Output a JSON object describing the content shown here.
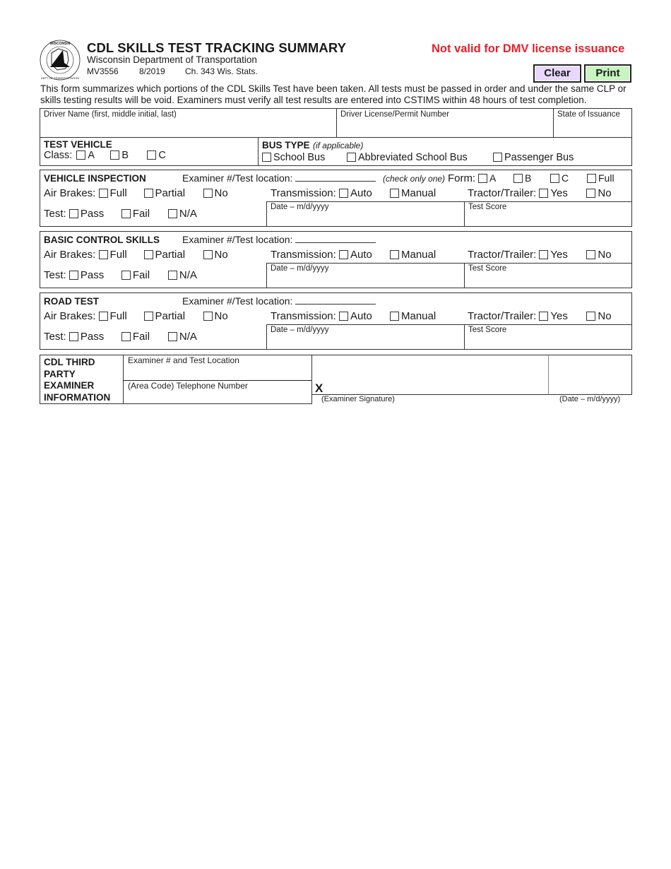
{
  "header": {
    "logo_text_top": "WISCONSIN",
    "logo_text_bottom": "DEPARTMENT OF TRANSPORTATION",
    "title": "CDL SKILLS TEST TRACKING SUMMARY",
    "department": "Wisconsin Department of Transportation",
    "form_number": "MV3556",
    "form_date": "8/2019",
    "statute": "Ch. 343 Wis. Stats.",
    "warning": "Not valid for DMV license issuance",
    "clear_label": "Clear",
    "print_label": "Print",
    "colors": {
      "warning": "#e8202a",
      "clear_bg": "#e8d8ff",
      "print_bg": "#c8f5c0"
    }
  },
  "intro": "This form summarizes which portions of the CDL Skills Test have been taken. All tests must be passed in order and under the same CLP or skills testing results will be void. Examiners must verify all test results are entered into CSTIMS within 48 hours of test completion.",
  "driver": {
    "name_label": "Driver Name (first, middle initial, last)",
    "name_value": "",
    "license_label": "Driver License/Permit Number",
    "license_value": "",
    "state_label": "State of Issuance",
    "state_value": ""
  },
  "test_vehicle": {
    "title": "TEST VEHICLE",
    "class_label": "Class:",
    "classes": [
      "A",
      "B",
      "C"
    ]
  },
  "bus_type": {
    "title": "BUS TYPE",
    "note": "(if applicable)",
    "options": [
      "School Bus",
      "Abbreviated School Bus",
      "Passenger Bus"
    ]
  },
  "sections": [
    {
      "title": "VEHICLE INSPECTION",
      "examiner_label": "Examiner #/Test location:",
      "form_note": "(check only one)",
      "form_label": "Form:",
      "form_options": [
        "A",
        "B",
        "C",
        "Full"
      ],
      "air_brakes_label": "Air Brakes:",
      "air_brakes_options": [
        "Full",
        "Partial",
        "No"
      ],
      "transmission_label": "Transmission:",
      "transmission_options": [
        "Auto",
        "Manual"
      ],
      "tractor_label": "Tractor/Trailer:",
      "tractor_options": [
        "Yes",
        "No"
      ],
      "test_label": "Test:",
      "test_options": [
        "Pass",
        "Fail",
        "N/A"
      ],
      "date_label": "Date – m/d/yyyy",
      "score_label": "Test Score"
    },
    {
      "title": "BASIC CONTROL SKILLS",
      "examiner_label": "Examiner #/Test location:",
      "air_brakes_label": "Air Brakes:",
      "air_brakes_options": [
        "Full",
        "Partial",
        "No"
      ],
      "transmission_label": "Transmission:",
      "transmission_options": [
        "Auto",
        "Manual"
      ],
      "tractor_label": "Tractor/Trailer:",
      "tractor_options": [
        "Yes",
        "No"
      ],
      "test_label": "Test:",
      "test_options": [
        "Pass",
        "Fail",
        "N/A"
      ],
      "date_label": "Date – m/d/yyyy",
      "score_label": "Test Score"
    },
    {
      "title": "ROAD TEST",
      "examiner_label": "Examiner #/Test location:",
      "air_brakes_label": "Air Brakes:",
      "air_brakes_options": [
        "Full",
        "Partial",
        "No"
      ],
      "transmission_label": "Transmission:",
      "transmission_options": [
        "Auto",
        "Manual"
      ],
      "tractor_label": "Tractor/Trailer:",
      "tractor_options": [
        "Yes",
        "No"
      ],
      "test_label": "Test:",
      "test_options": [
        "Pass",
        "Fail",
        "N/A"
      ],
      "date_label": "Date – m/d/yyyy",
      "score_label": "Test Score"
    }
  ],
  "third_party": {
    "title_lines": [
      "CDL THIRD",
      "PARTY",
      "EXAMINER",
      "INFORMATION"
    ],
    "examiner_location_label": "Examiner # and Test Location",
    "phone_label": "(Area Code) Telephone Number",
    "signature_mark": "X",
    "signature_caption": "(Examiner Signature)",
    "date_caption": "(Date – m/d/yyyy)"
  }
}
